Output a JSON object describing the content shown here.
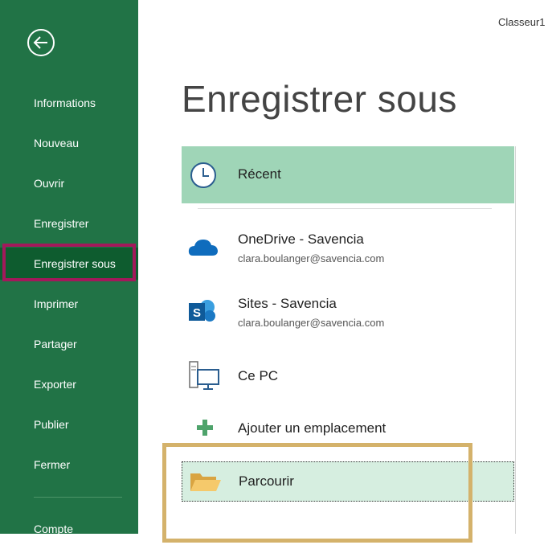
{
  "window": {
    "workbook_title": "Classeur1"
  },
  "sidebar": {
    "back_icon": "back-arrow-circle-icon",
    "items": [
      {
        "label": "Informations"
      },
      {
        "label": "Nouveau"
      },
      {
        "label": "Ouvrir"
      },
      {
        "label": "Enregistrer"
      },
      {
        "label": "Enregistrer sous",
        "active": true
      },
      {
        "label": "Imprimer"
      },
      {
        "label": "Partager"
      },
      {
        "label": "Exporter"
      },
      {
        "label": "Publier"
      },
      {
        "label": "Fermer"
      },
      {
        "label": "Compte"
      }
    ]
  },
  "main": {
    "title": "Enregistrer sous",
    "locations": [
      {
        "label": "Récent",
        "icon": "clock-icon",
        "selected": true
      },
      {
        "label": "OneDrive - Savencia",
        "sub": "clara.boulanger@savencia.com",
        "icon": "cloud-icon"
      },
      {
        "label": "Sites - Savencia",
        "sub": "clara.boulanger@savencia.com",
        "icon": "sharepoint-icon"
      },
      {
        "label": "Ce PC",
        "icon": "computer-icon"
      },
      {
        "label": "Ajouter un emplacement",
        "icon": "plus-icon"
      },
      {
        "label": "Parcourir",
        "icon": "folder-icon",
        "focused": true
      }
    ]
  },
  "colors": {
    "sidebar_bg": "#217346",
    "sidebar_active": "#0e5c2f",
    "selected_bg": "#9fd5b7",
    "browse_bg": "#d6eee0",
    "annotation_red": "#a3195b",
    "annotation_gold": "#d4b26b"
  }
}
